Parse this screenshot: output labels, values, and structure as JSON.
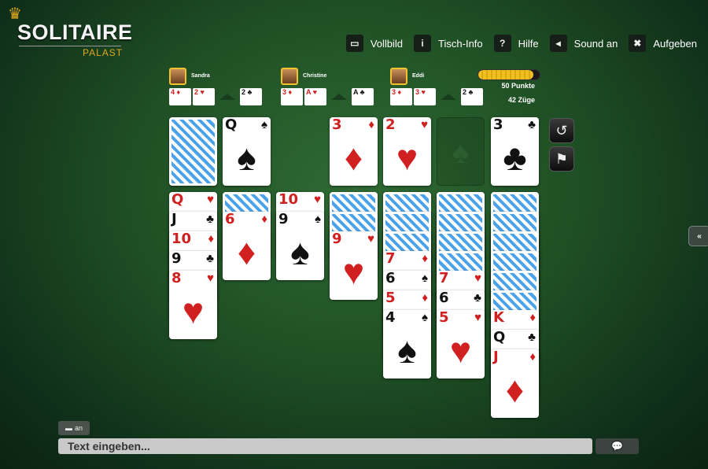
{
  "logo": {
    "title": "SOLITAIRE",
    "subtitle": "PALAST",
    "icon": "crown-icon"
  },
  "menu": [
    {
      "label": "Vollbild",
      "icon": "monitor-icon",
      "glyph": "▭"
    },
    {
      "label": "Tisch-Info",
      "icon": "info-icon",
      "glyph": "i"
    },
    {
      "label": "Hilfe",
      "icon": "help-icon",
      "glyph": "?"
    },
    {
      "label": "Sound an",
      "icon": "speaker-icon",
      "glyph": "◂"
    },
    {
      "label": "Aufgeben",
      "icon": "close-icon",
      "glyph": "✖"
    }
  ],
  "players": [
    {
      "name": "Sandra",
      "cards": [
        {
          "rank": "4",
          "suit": "♦",
          "color": "red"
        },
        {
          "rank": "2",
          "suit": "♥",
          "color": "red"
        },
        {
          "rank": "2",
          "suit": "♣",
          "color": "black"
        }
      ]
    },
    {
      "name": "Christine",
      "cards": [
        {
          "rank": "3",
          "suit": "♦",
          "color": "red"
        },
        {
          "rank": "A",
          "suit": "♥",
          "color": "red"
        },
        {
          "rank": "A",
          "suit": "♣",
          "color": "black"
        }
      ]
    },
    {
      "name": "Eddi",
      "cards": [
        {
          "rank": "3",
          "suit": "♦",
          "color": "red"
        },
        {
          "rank": "3",
          "suit": "♥",
          "color": "red"
        },
        {
          "rank": "2",
          "suit": "♣",
          "color": "black"
        }
      ]
    }
  ],
  "score": {
    "points": "50 Punkte",
    "moves": "42 Züge",
    "progress_percent": 90
  },
  "stock": {
    "face_down": true
  },
  "waste": {
    "rank": "Q",
    "suit": "♠",
    "color": "black"
  },
  "foundations": [
    {
      "rank": "3",
      "suit": "♦",
      "color": "red"
    },
    {
      "rank": "2",
      "suit": "♥",
      "color": "red"
    },
    {
      "empty": true,
      "placeholder_suit": "♠"
    },
    {
      "rank": "3",
      "suit": "♣",
      "color": "black"
    }
  ],
  "tableau": [
    {
      "hidden": 0,
      "cards": [
        {
          "rank": "Q",
          "suit": "♥",
          "color": "red"
        },
        {
          "rank": "J",
          "suit": "♣",
          "color": "black"
        },
        {
          "rank": "10",
          "suit": "♦",
          "color": "red"
        },
        {
          "rank": "9",
          "suit": "♣",
          "color": "black"
        },
        {
          "rank": "8",
          "suit": "♥",
          "color": "red"
        }
      ]
    },
    {
      "hidden": 1,
      "cards": [
        {
          "rank": "6",
          "suit": "♦",
          "color": "red"
        }
      ]
    },
    {
      "hidden": 0,
      "cards": [
        {
          "rank": "10",
          "suit": "♥",
          "color": "red"
        },
        {
          "rank": "9",
          "suit": "♠",
          "color": "black"
        }
      ]
    },
    {
      "hidden": 2,
      "cards": [
        {
          "rank": "9",
          "suit": "♥",
          "color": "red"
        }
      ]
    },
    {
      "hidden": 3,
      "cards": [
        {
          "rank": "7",
          "suit": "♦",
          "color": "red"
        },
        {
          "rank": "6",
          "suit": "♠",
          "color": "black"
        },
        {
          "rank": "5",
          "suit": "♦",
          "color": "red"
        },
        {
          "rank": "4",
          "suit": "♠",
          "color": "black"
        }
      ]
    },
    {
      "hidden": 4,
      "cards": [
        {
          "rank": "7",
          "suit": "♥",
          "color": "red"
        },
        {
          "rank": "6",
          "suit": "♣",
          "color": "black"
        },
        {
          "rank": "5",
          "suit": "♥",
          "color": "red"
        }
      ]
    },
    {
      "hidden": 6,
      "cards": [
        {
          "rank": "K",
          "suit": "♦",
          "color": "red"
        },
        {
          "rank": "Q",
          "suit": "♣",
          "color": "black"
        },
        {
          "rank": "J",
          "suit": "♦",
          "color": "red"
        }
      ]
    }
  ],
  "controls": {
    "undo_icon": "undo-icon",
    "flag_icon": "flag-icon"
  },
  "side_tab": {
    "label": "«"
  },
  "chat": {
    "toggle_label": "an",
    "placeholder": "Text eingeben...",
    "send_icon": "chat-bubble-icon"
  }
}
